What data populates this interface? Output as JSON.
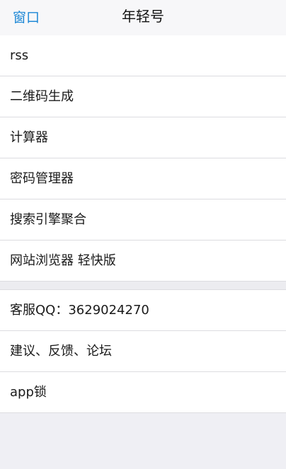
{
  "navbar": {
    "back_label": "窗口",
    "title": "年轻号"
  },
  "group1": {
    "items": [
      {
        "label": "rss"
      },
      {
        "label": "二维码生成"
      },
      {
        "label": "计算器"
      },
      {
        "label": "密码管理器"
      },
      {
        "label": "搜索引擎聚合"
      },
      {
        "label": "网站浏览器 轻快版"
      }
    ]
  },
  "group2": {
    "items": [
      {
        "label": "客服QQ：3629024270"
      },
      {
        "label": "建议、反馈、论坛"
      },
      {
        "label": "app锁"
      }
    ]
  },
  "colors": {
    "accent": "#1e88d6",
    "background": "#efeff4",
    "cell": "#ffffff",
    "separator": "#dcdce0"
  }
}
